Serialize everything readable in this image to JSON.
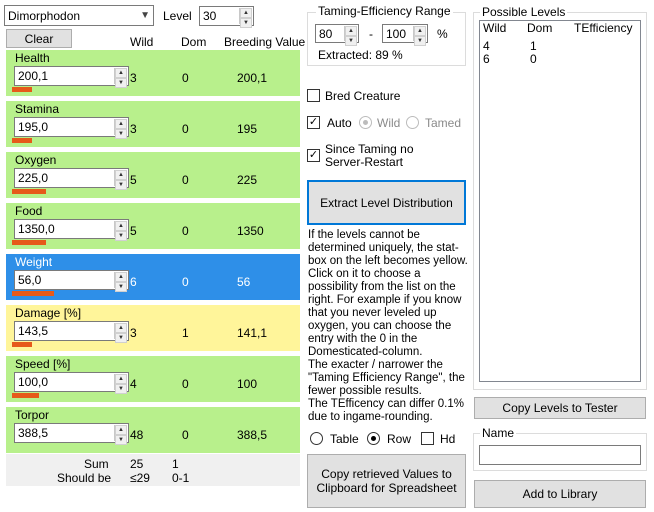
{
  "top": {
    "creature": "Dimorphodon",
    "level_label": "Level",
    "level_value": "30",
    "clear_button": "Clear"
  },
  "columns": {
    "wild": "Wild",
    "dom": "Dom",
    "breeding": "Breeding Value"
  },
  "colors": {
    "green": "#b8f08c",
    "blue": "#2e8fe8",
    "yellow": "#fff59a",
    "bar": "#e65a1a"
  },
  "stats": [
    {
      "name": "Health",
      "value": "200,1",
      "wild": "3",
      "dom": "0",
      "breeding": "200,1"
    },
    {
      "name": "Stamina",
      "value": "195,0",
      "wild": "3",
      "dom": "0",
      "breeding": "195"
    },
    {
      "name": "Oxygen",
      "value": "225,0",
      "wild": "5",
      "dom": "0",
      "breeding": "225"
    },
    {
      "name": "Food",
      "value": "1350,0",
      "wild": "5",
      "dom": "0",
      "breeding": "1350"
    },
    {
      "name": "Weight",
      "value": "56,0",
      "wild": "6",
      "dom": "0",
      "breeding": "56"
    },
    {
      "name": "Damage [%]",
      "value": "143,5",
      "wild": "3",
      "dom": "1",
      "breeding": "141,1"
    },
    {
      "name": "Speed [%]",
      "value": "100,0",
      "wild": "4",
      "dom": "0",
      "breeding": "100"
    },
    {
      "name": "Torpor",
      "value": "388,5",
      "wild": "48",
      "dom": "0",
      "breeding": "388,5"
    }
  ],
  "summary": {
    "sum_label": "Sum",
    "sum_wild": "25",
    "sum_dom": "1",
    "should_label": "Should be",
    "should_wild": "≤29",
    "should_dom": "0-1"
  },
  "taming": {
    "title": "Taming-Efficiency Range",
    "min": "80",
    "dash": "-",
    "max": "100",
    "percent": "%",
    "extracted": "Extracted: 89 %"
  },
  "options": {
    "bred": "Bred Creature",
    "auto": "Auto",
    "wild": "Wild",
    "tamed": "Tamed",
    "since_taming": "Since Taming no Server-Restart"
  },
  "extract_button": "Extract Level Distribution",
  "info_text": "If the levels cannot be determined uniquely, the stat-box on the left becomes yellow. Click on it to choose a possibility from the list on the right. For example if you know that you never leveled up oxygen, you can choose the entry with the 0 in the Domesticated-column.\nThe exacter / narrower the \"Taming Efficiency Range\", the fewer possible results.\nThe TEfficency can differ 0.1% due to ingame-rounding.",
  "output_mode": {
    "table": "Table",
    "row": "Row",
    "hd": "Hd"
  },
  "copy_values_button": "Copy retrieved Values to Clipboard for Spreadsheet",
  "possible": {
    "title": "Possible Levels",
    "headers": [
      "Wild",
      "Dom",
      "TEfficiency"
    ],
    "rows": [
      {
        "wild": "4",
        "dom": "1"
      },
      {
        "wild": "6",
        "dom": "0"
      }
    ]
  },
  "copy_levels_button": "Copy Levels to Tester",
  "name_group": {
    "title": "Name",
    "value": ""
  },
  "add_library_button": "Add to Library"
}
